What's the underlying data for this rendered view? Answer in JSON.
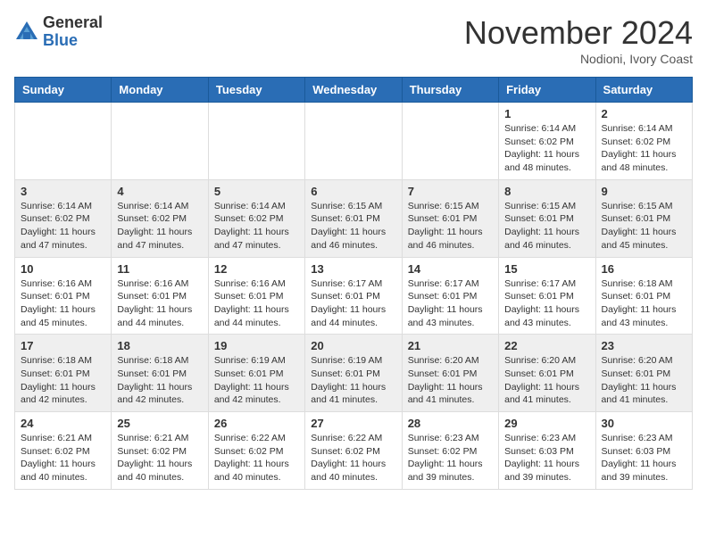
{
  "header": {
    "logo_line1": "General",
    "logo_line2": "Blue",
    "month_title": "November 2024",
    "location": "Nodioni, Ivory Coast"
  },
  "weekdays": [
    "Sunday",
    "Monday",
    "Tuesday",
    "Wednesday",
    "Thursday",
    "Friday",
    "Saturday"
  ],
  "weeks": [
    [
      {
        "day": "",
        "info": ""
      },
      {
        "day": "",
        "info": ""
      },
      {
        "day": "",
        "info": ""
      },
      {
        "day": "",
        "info": ""
      },
      {
        "day": "",
        "info": ""
      },
      {
        "day": "1",
        "info": "Sunrise: 6:14 AM\nSunset: 6:02 PM\nDaylight: 11 hours\nand 48 minutes."
      },
      {
        "day": "2",
        "info": "Sunrise: 6:14 AM\nSunset: 6:02 PM\nDaylight: 11 hours\nand 48 minutes."
      }
    ],
    [
      {
        "day": "3",
        "info": "Sunrise: 6:14 AM\nSunset: 6:02 PM\nDaylight: 11 hours\nand 47 minutes."
      },
      {
        "day": "4",
        "info": "Sunrise: 6:14 AM\nSunset: 6:02 PM\nDaylight: 11 hours\nand 47 minutes."
      },
      {
        "day": "5",
        "info": "Sunrise: 6:14 AM\nSunset: 6:02 PM\nDaylight: 11 hours\nand 47 minutes."
      },
      {
        "day": "6",
        "info": "Sunrise: 6:15 AM\nSunset: 6:01 PM\nDaylight: 11 hours\nand 46 minutes."
      },
      {
        "day": "7",
        "info": "Sunrise: 6:15 AM\nSunset: 6:01 PM\nDaylight: 11 hours\nand 46 minutes."
      },
      {
        "day": "8",
        "info": "Sunrise: 6:15 AM\nSunset: 6:01 PM\nDaylight: 11 hours\nand 46 minutes."
      },
      {
        "day": "9",
        "info": "Sunrise: 6:15 AM\nSunset: 6:01 PM\nDaylight: 11 hours\nand 45 minutes."
      }
    ],
    [
      {
        "day": "10",
        "info": "Sunrise: 6:16 AM\nSunset: 6:01 PM\nDaylight: 11 hours\nand 45 minutes."
      },
      {
        "day": "11",
        "info": "Sunrise: 6:16 AM\nSunset: 6:01 PM\nDaylight: 11 hours\nand 44 minutes."
      },
      {
        "day": "12",
        "info": "Sunrise: 6:16 AM\nSunset: 6:01 PM\nDaylight: 11 hours\nand 44 minutes."
      },
      {
        "day": "13",
        "info": "Sunrise: 6:17 AM\nSunset: 6:01 PM\nDaylight: 11 hours\nand 44 minutes."
      },
      {
        "day": "14",
        "info": "Sunrise: 6:17 AM\nSunset: 6:01 PM\nDaylight: 11 hours\nand 43 minutes."
      },
      {
        "day": "15",
        "info": "Sunrise: 6:17 AM\nSunset: 6:01 PM\nDaylight: 11 hours\nand 43 minutes."
      },
      {
        "day": "16",
        "info": "Sunrise: 6:18 AM\nSunset: 6:01 PM\nDaylight: 11 hours\nand 43 minutes."
      }
    ],
    [
      {
        "day": "17",
        "info": "Sunrise: 6:18 AM\nSunset: 6:01 PM\nDaylight: 11 hours\nand 42 minutes."
      },
      {
        "day": "18",
        "info": "Sunrise: 6:18 AM\nSunset: 6:01 PM\nDaylight: 11 hours\nand 42 minutes."
      },
      {
        "day": "19",
        "info": "Sunrise: 6:19 AM\nSunset: 6:01 PM\nDaylight: 11 hours\nand 42 minutes."
      },
      {
        "day": "20",
        "info": "Sunrise: 6:19 AM\nSunset: 6:01 PM\nDaylight: 11 hours\nand 41 minutes."
      },
      {
        "day": "21",
        "info": "Sunrise: 6:20 AM\nSunset: 6:01 PM\nDaylight: 11 hours\nand 41 minutes."
      },
      {
        "day": "22",
        "info": "Sunrise: 6:20 AM\nSunset: 6:01 PM\nDaylight: 11 hours\nand 41 minutes."
      },
      {
        "day": "23",
        "info": "Sunrise: 6:20 AM\nSunset: 6:01 PM\nDaylight: 11 hours\nand 41 minutes."
      }
    ],
    [
      {
        "day": "24",
        "info": "Sunrise: 6:21 AM\nSunset: 6:02 PM\nDaylight: 11 hours\nand 40 minutes."
      },
      {
        "day": "25",
        "info": "Sunrise: 6:21 AM\nSunset: 6:02 PM\nDaylight: 11 hours\nand 40 minutes."
      },
      {
        "day": "26",
        "info": "Sunrise: 6:22 AM\nSunset: 6:02 PM\nDaylight: 11 hours\nand 40 minutes."
      },
      {
        "day": "27",
        "info": "Sunrise: 6:22 AM\nSunset: 6:02 PM\nDaylight: 11 hours\nand 40 minutes."
      },
      {
        "day": "28",
        "info": "Sunrise: 6:23 AM\nSunset: 6:02 PM\nDaylight: 11 hours\nand 39 minutes."
      },
      {
        "day": "29",
        "info": "Sunrise: 6:23 AM\nSunset: 6:03 PM\nDaylight: 11 hours\nand 39 minutes."
      },
      {
        "day": "30",
        "info": "Sunrise: 6:23 AM\nSunset: 6:03 PM\nDaylight: 11 hours\nand 39 minutes."
      }
    ]
  ]
}
